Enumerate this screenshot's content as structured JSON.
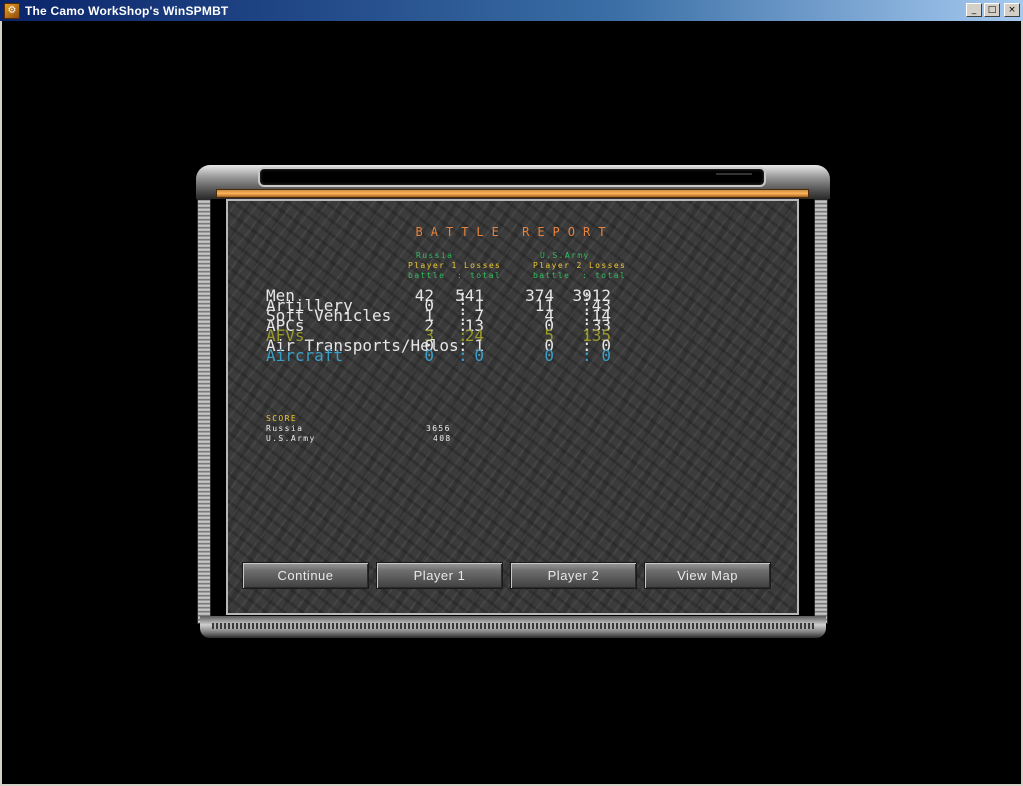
{
  "window": {
    "title": "The Camo WorkShop's WinSPMBT",
    "controls": {
      "minimize": "_",
      "maximize": "□",
      "close": "×"
    }
  },
  "report": {
    "title": "BATTLE REPORT",
    "player1_name": "Russia",
    "player2_name": "U.S.Army",
    "player1_losses_label": "Player 1 Losses",
    "player2_losses_label": "Player 2 Losses",
    "battle_label": "battle",
    "total_label": "total",
    "separator": ":",
    "rows": [
      {
        "label": "Men",
        "p1_battle": "42",
        "p1_total": "541",
        "p2_battle": "374",
        "p2_total": "3912",
        "color": "#e6e6e6"
      },
      {
        "label": "Artillery",
        "p1_battle": "0",
        "p1_total": "1",
        "p2_battle": "11",
        "p2_total": "43",
        "color": "#e6e6e6"
      },
      {
        "label": "Soft Vehicles",
        "p1_battle": "1",
        "p1_total": "7",
        "p2_battle": "4",
        "p2_total": "14",
        "color": "#e6e6e6"
      },
      {
        "label": "APCs",
        "p1_battle": "2",
        "p1_total": "13",
        "p2_battle": "0",
        "p2_total": "33",
        "color": "#e6e6e6"
      },
      {
        "label": "AFVs",
        "p1_battle": "3",
        "p1_total": "24",
        "p2_battle": "5",
        "p2_total": "135",
        "color": "#9a9a2a"
      },
      {
        "label": "Air Transports/Helos",
        "p1_battle": "0",
        "p1_total": "1",
        "p2_battle": "0",
        "p2_total": "0",
        "color": "#e6e6e6"
      },
      {
        "label": "Aircraft",
        "p1_battle": "0",
        "p1_total": "0",
        "p2_battle": "0",
        "p2_total": "0",
        "color": "#3a9fc8"
      }
    ],
    "score": {
      "label": "SCORE",
      "entries": [
        {
          "name": "Russia",
          "value": "3656"
        },
        {
          "name": "U.S.Army",
          "value": "408"
        }
      ]
    }
  },
  "buttons": {
    "continue": "Continue",
    "player1": "Player 1",
    "player2": "Player 2",
    "view_map": "View Map"
  },
  "colors": {
    "title": "#e8823c",
    "player_name": "#2fbf5f",
    "losses_header": "#f0c830",
    "battle_total": "#2fbf5f"
  }
}
